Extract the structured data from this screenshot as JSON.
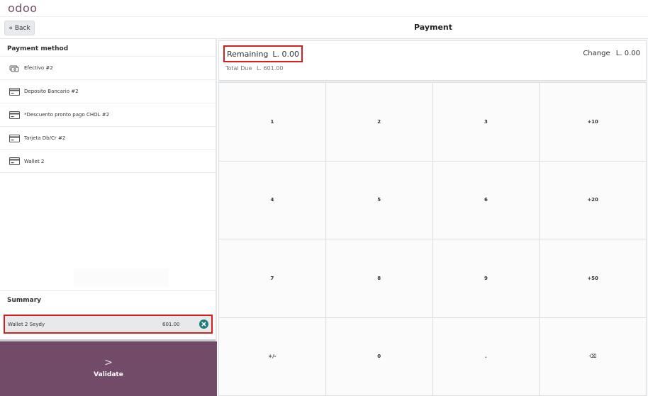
{
  "app": {
    "logo_text": "odoo"
  },
  "header": {
    "back_label": "Back",
    "back_icon": "double-chevron-left-icon",
    "title": "Payment"
  },
  "payment_methods": {
    "title": "Payment method",
    "items": [
      {
        "label": "Efectivo #2",
        "icon": "cash-icon"
      },
      {
        "label": "Deposito Bancario #2",
        "icon": "card-icon"
      },
      {
        "label": "*Descuento pronto pago CHOL #2",
        "icon": "card-icon"
      },
      {
        "label": "Tarjeta Db/Cr #2",
        "icon": "card-icon"
      },
      {
        "label": "Wallet 2",
        "icon": "card-icon"
      }
    ]
  },
  "summary": {
    "title": "Summary",
    "lines": [
      {
        "name": "Wallet 2 Seydy",
        "amount": "601.00",
        "remove_icon": "remove-circle-icon"
      }
    ]
  },
  "validate": {
    "label": "Validate",
    "icon": "chevron-right-icon"
  },
  "status": {
    "remaining_label": "Remaining",
    "remaining_value": "L. 0.00",
    "total_due_label": "Total Due",
    "total_due_value": "L. 601.00",
    "change_label": "Change",
    "change_value": "L. 0.00"
  },
  "numpad": {
    "keys": [
      "1",
      "2",
      "3",
      "+10",
      "4",
      "5",
      "6",
      "+20",
      "7",
      "8",
      "9",
      "+50",
      "+/-",
      "0",
      ".",
      "⌫"
    ]
  },
  "colors": {
    "brand": "#714b67",
    "highlight_border": "#d61f1f",
    "remove_icon": "#1e7d7a"
  }
}
